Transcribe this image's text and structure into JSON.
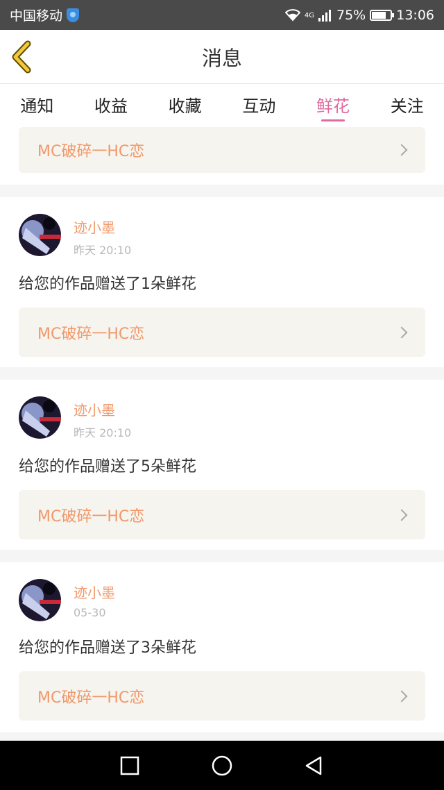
{
  "status_bar": {
    "carrier": "中国移动",
    "network": "4G",
    "battery": "75%",
    "battery_level": 0.75,
    "time": "13:06"
  },
  "header": {
    "title": "消息"
  },
  "tabs": [
    {
      "label": "通知",
      "active": false
    },
    {
      "label": "收益",
      "active": false
    },
    {
      "label": "收藏",
      "active": false
    },
    {
      "label": "互动",
      "active": false
    },
    {
      "label": "鲜花",
      "active": true
    },
    {
      "label": "关注",
      "active": false
    }
  ],
  "top_work": {
    "title": "MC破碎一HC恋"
  },
  "messages": [
    {
      "username": "迹小墨",
      "time": "昨天 20:10",
      "text": "给您的作品赠送了1朵鲜花",
      "work": "MC破碎一HC恋"
    },
    {
      "username": "迹小墨",
      "time": "昨天 20:10",
      "text": "给您的作品赠送了5朵鲜花",
      "work": "MC破碎一HC恋"
    },
    {
      "username": "迹小墨",
      "time": "05-30",
      "text": "给您的作品赠送了3朵鲜花",
      "work": "MC破碎一HC恋"
    }
  ],
  "colors": {
    "accent": "#e06aa1",
    "username": "#f0986a",
    "work_bg": "#f5f4ee"
  }
}
